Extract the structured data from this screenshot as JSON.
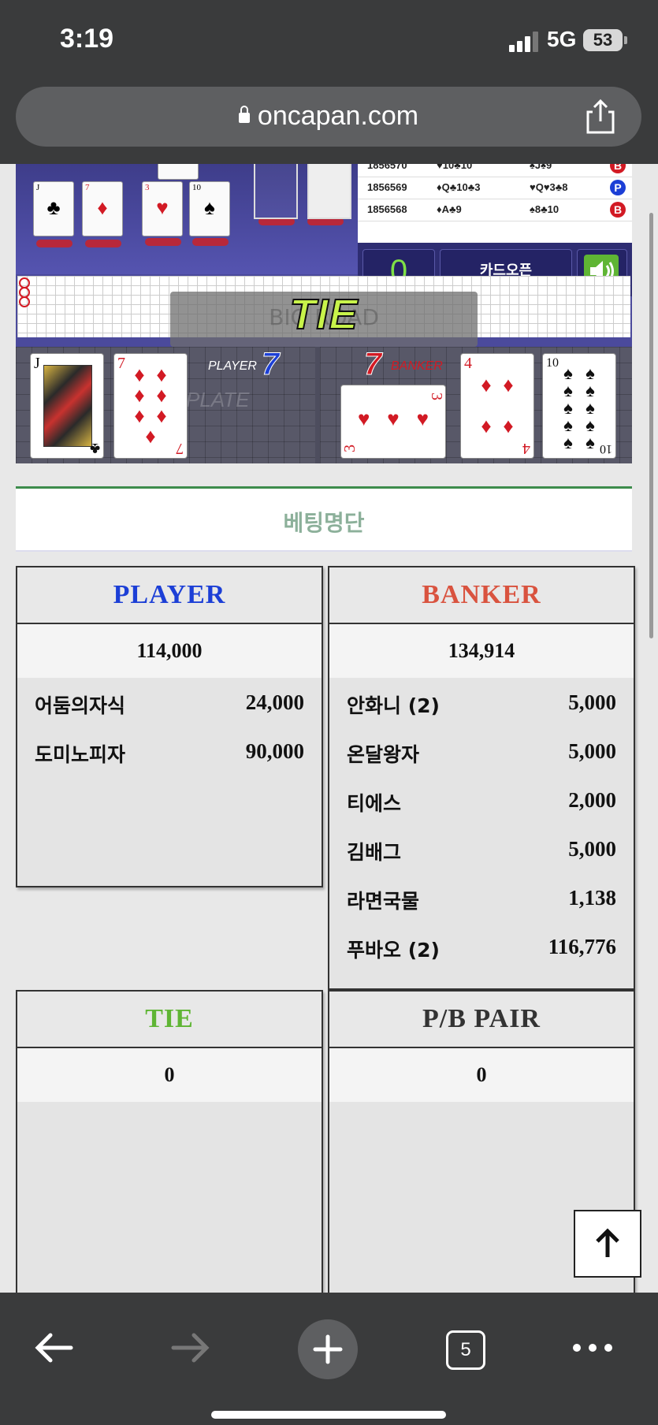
{
  "status": {
    "time": "3:19",
    "network": "5G",
    "battery": "53"
  },
  "browser": {
    "url": "oncapan.com",
    "tab_count": "5"
  },
  "game": {
    "history": [
      {
        "round": "1856570",
        "player": "♥10♣10",
        "banker": "♠J♠9",
        "result": "B"
      },
      {
        "round": "1856569",
        "player": "♦Q♣10♣3",
        "banker": "♥Q♥3♣8",
        "result": "P"
      },
      {
        "round": "1856568",
        "player": "♦A♣9",
        "banker": "♠8♣10",
        "result": "B"
      }
    ],
    "counter": "0",
    "card_open_label": "카드오픈",
    "road_label": "BIG ROAD",
    "result_banner": "TIE",
    "plate_label": "PLATE",
    "player_label": "PLAYER",
    "player_score": "7",
    "banker_label": "BANKER",
    "banker_score": "7",
    "player_cards": [
      {
        "rank": "J",
        "suit": "♣",
        "color": "#111111"
      },
      {
        "rank": "7",
        "suit": "♦",
        "color": "#d21a24"
      }
    ],
    "banker_cards": [
      {
        "rank": "3",
        "suit": "♥",
        "color": "#d21a24"
      },
      {
        "rank": "4",
        "suit": "♦",
        "color": "#d21a24"
      },
      {
        "rank": "10",
        "suit": "♠",
        "color": "#111111"
      }
    ]
  },
  "betting": {
    "title": "베팅명단",
    "player": {
      "label": "PLAYER",
      "color": "#1c3fd6",
      "total": "114,000",
      "bets": [
        {
          "name": "어둠의자식",
          "amount": "24,000"
        },
        {
          "name": "도미노피자",
          "amount": "90,000"
        }
      ]
    },
    "banker": {
      "label": "BANKER",
      "color": "#d9533f",
      "total": "134,914",
      "bets": [
        {
          "name": "안화니 (2)",
          "amount": "5,000"
        },
        {
          "name": "온달왕자",
          "amount": "5,000"
        },
        {
          "name": "티에스",
          "amount": "2,000"
        },
        {
          "name": "김배그",
          "amount": "5,000"
        },
        {
          "name": "라면국물",
          "amount": "1,138"
        },
        {
          "name": "푸바오 (2)",
          "amount": "116,776"
        }
      ]
    },
    "tie": {
      "label": "TIE",
      "color": "#5fb534",
      "total": "0"
    },
    "pair": {
      "label": "P/B PAIR",
      "color": "#333333",
      "total": "0"
    }
  },
  "icons": {
    "lock": "lock-icon",
    "share": "share-icon",
    "back": "arrow-left-icon",
    "forward": "arrow-right-icon",
    "new_tab": "plus-icon",
    "tabs": "tabs-icon",
    "more": "more-icon",
    "sound": "speaker-icon",
    "scroll_top": "arrow-up-icon"
  }
}
